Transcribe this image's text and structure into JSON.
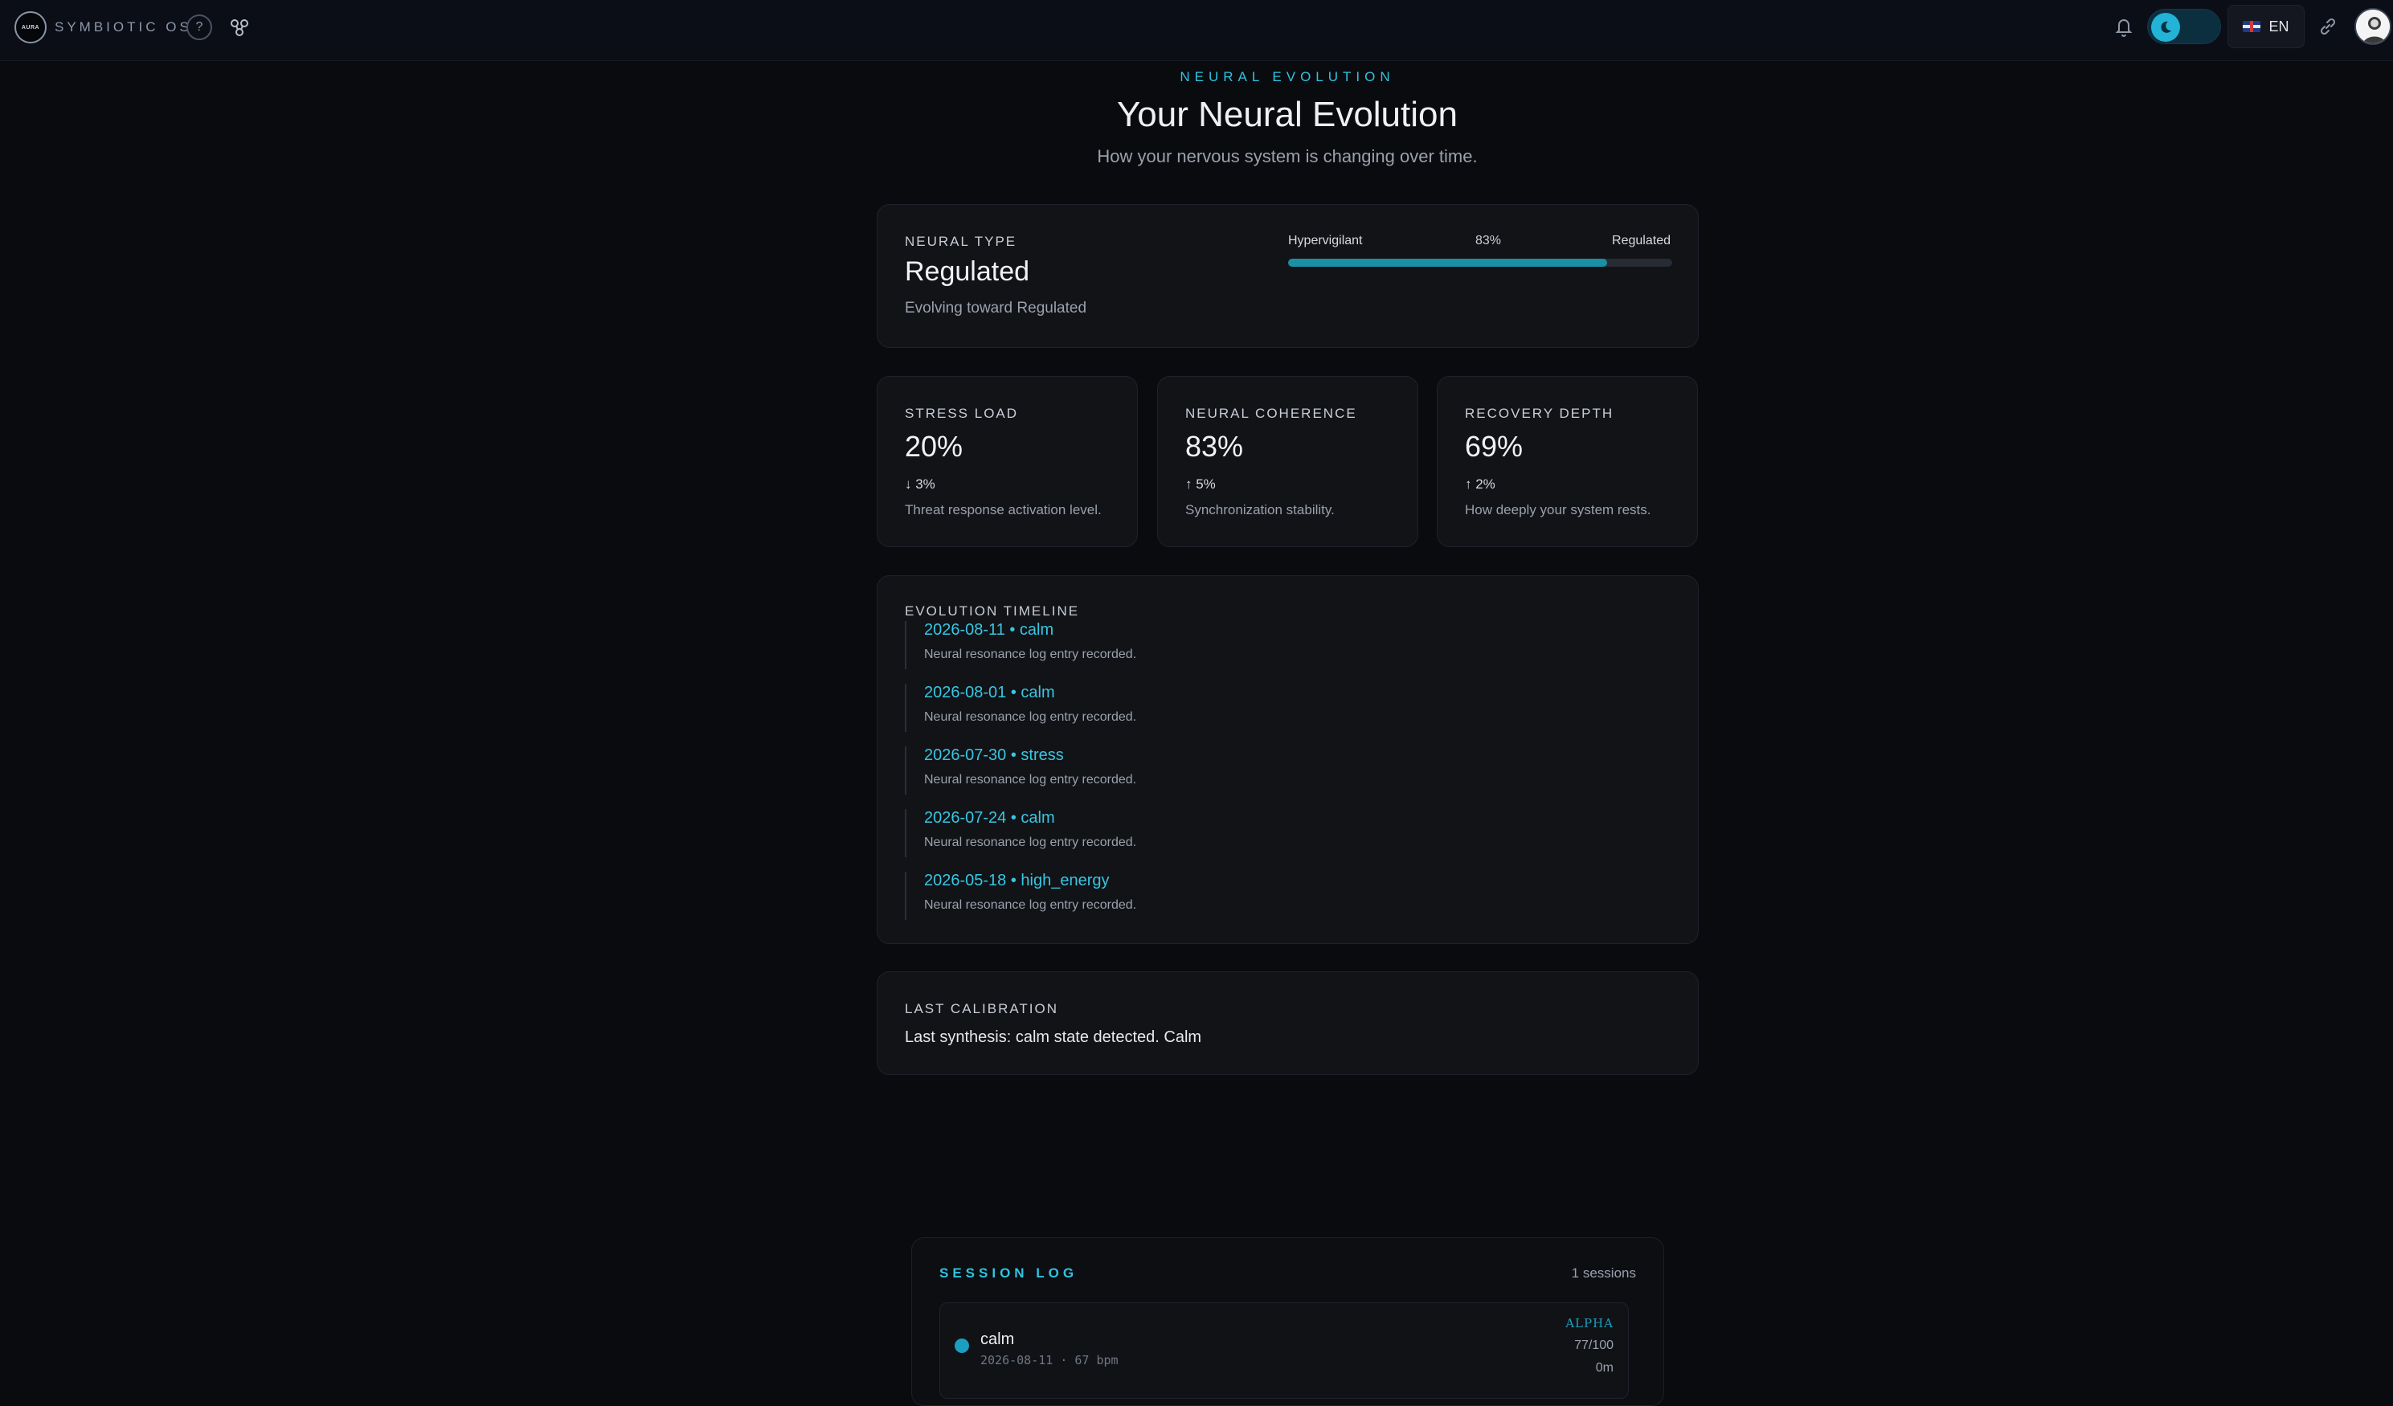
{
  "topbar": {
    "logo_text": "AURA",
    "brand": "SYMBIOTIC OS",
    "help_label": "?",
    "language": "EN",
    "icons": {
      "help": "question-icon",
      "network": "network-icon",
      "bell": "bell-icon",
      "theme": "moon-icon",
      "flag": "uk-flag-icon",
      "link": "link-icon"
    }
  },
  "header": {
    "eyebrow": "NEURAL EVOLUTION",
    "title": "Your Neural Evolution",
    "subtitle": "How your nervous system is changing over time."
  },
  "neural_type": {
    "label": "NEURAL TYPE",
    "value": "Regulated",
    "evolving": "Evolving toward Regulated",
    "scale_left": "Hypervigilant",
    "scale_right": "Regulated",
    "scale_pct_label": "83%",
    "scale_fraction": 0.83
  },
  "metrics": [
    {
      "label": "STRESS LOAD",
      "value": "20%",
      "delta": "↓ 3%",
      "desc": "Threat response activation level."
    },
    {
      "label": "NEURAL COHERENCE",
      "value": "83%",
      "delta": "↑ 5%",
      "desc": "Synchronization stability."
    },
    {
      "label": "RECOVERY DEPTH",
      "value": "69%",
      "delta": "↑ 2%",
      "desc": "How deeply your system rests."
    }
  ],
  "timeline": {
    "label": "EVOLUTION TIMELINE",
    "entries": [
      {
        "head": "2026-08-11 • calm",
        "body": "Neural resonance log entry recorded."
      },
      {
        "head": "2026-08-01 • calm",
        "body": "Neural resonance log entry recorded."
      },
      {
        "head": "2026-07-30 • stress",
        "body": "Neural resonance log entry recorded."
      },
      {
        "head": "2026-07-24 • calm",
        "body": "Neural resonance log entry recorded."
      },
      {
        "head": "2026-05-18 • high_energy",
        "body": "Neural resonance log entry recorded."
      }
    ]
  },
  "calibration": {
    "label": "LAST CALIBRATION",
    "text": "Last synthesis: calm state detected. Calm"
  },
  "session_log": {
    "title": "SESSION LOG",
    "count": "1 sessions",
    "rows": [
      {
        "state": "calm",
        "meta": "2026-08-11 · 67 bpm",
        "band": "ALPHA",
        "score": "77/100",
        "duration": "0m"
      }
    ]
  },
  "colors": {
    "accent": "#2fc4e0",
    "background": "#0a0b0e",
    "card": "#111317"
  }
}
